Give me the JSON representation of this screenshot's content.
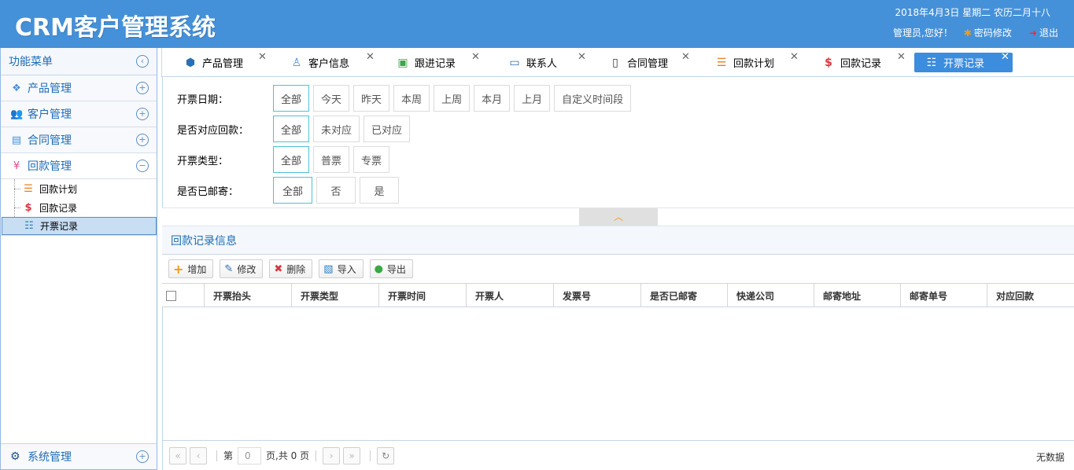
{
  "header": {
    "title": "CRM客户管理系统",
    "date": "2018年4月3日 星期二 农历二月十八",
    "greeting": "管理员,您好！",
    "change_password": "密码修改",
    "logout": "退出"
  },
  "sidebar": {
    "title": "功能菜单",
    "groups": [
      {
        "label": "产品管理"
      },
      {
        "label": "客户管理"
      },
      {
        "label": "合同管理"
      },
      {
        "label": "回款管理"
      }
    ],
    "sub_items": [
      {
        "label": "回款计划"
      },
      {
        "label": "回款记录"
      },
      {
        "label": "开票记录"
      }
    ],
    "bottom": {
      "label": "系统管理"
    }
  },
  "tabs": [
    {
      "label": "产品管理"
    },
    {
      "label": "客户信息"
    },
    {
      "label": "跟进记录"
    },
    {
      "label": "联系人"
    },
    {
      "label": "合同管理"
    },
    {
      "label": "回款计划"
    },
    {
      "label": "回款记录"
    },
    {
      "label": "开票记录"
    }
  ],
  "filters": {
    "date": {
      "label": "开票日期：",
      "options": [
        "全部",
        "今天",
        "昨天",
        "本周",
        "上周",
        "本月",
        "上月",
        "自定义时间段"
      ]
    },
    "matched": {
      "label": "是否对应回款：",
      "options": [
        "全部",
        "未对应",
        "已对应"
      ]
    },
    "type": {
      "label": "开票类型：",
      "options": [
        "全部",
        "普票",
        "专票"
      ]
    },
    "mailed": {
      "label": "是否已邮寄：",
      "options": [
        "全部",
        "否",
        "是"
      ]
    }
  },
  "panel": {
    "title": "回款记录信息"
  },
  "toolbar": {
    "add": "增加",
    "edit": "修改",
    "delete": "删除",
    "import": "导入",
    "export": "导出"
  },
  "columns": [
    "开票抬头",
    "开票类型",
    "开票时间",
    "开票人",
    "发票号",
    "是否已邮寄",
    "快递公司",
    "邮寄地址",
    "邮寄单号",
    "对应回款"
  ],
  "pager": {
    "page_prefix": "第",
    "page_value": "0",
    "page_suffix": "页,共 0 页",
    "info": "无数据"
  },
  "colors": {
    "header_bg": "#4591d9",
    "accent": "#1e6db8",
    "active_tab": "#3c8dde",
    "selected_filter_border": "#4fc1d6"
  }
}
